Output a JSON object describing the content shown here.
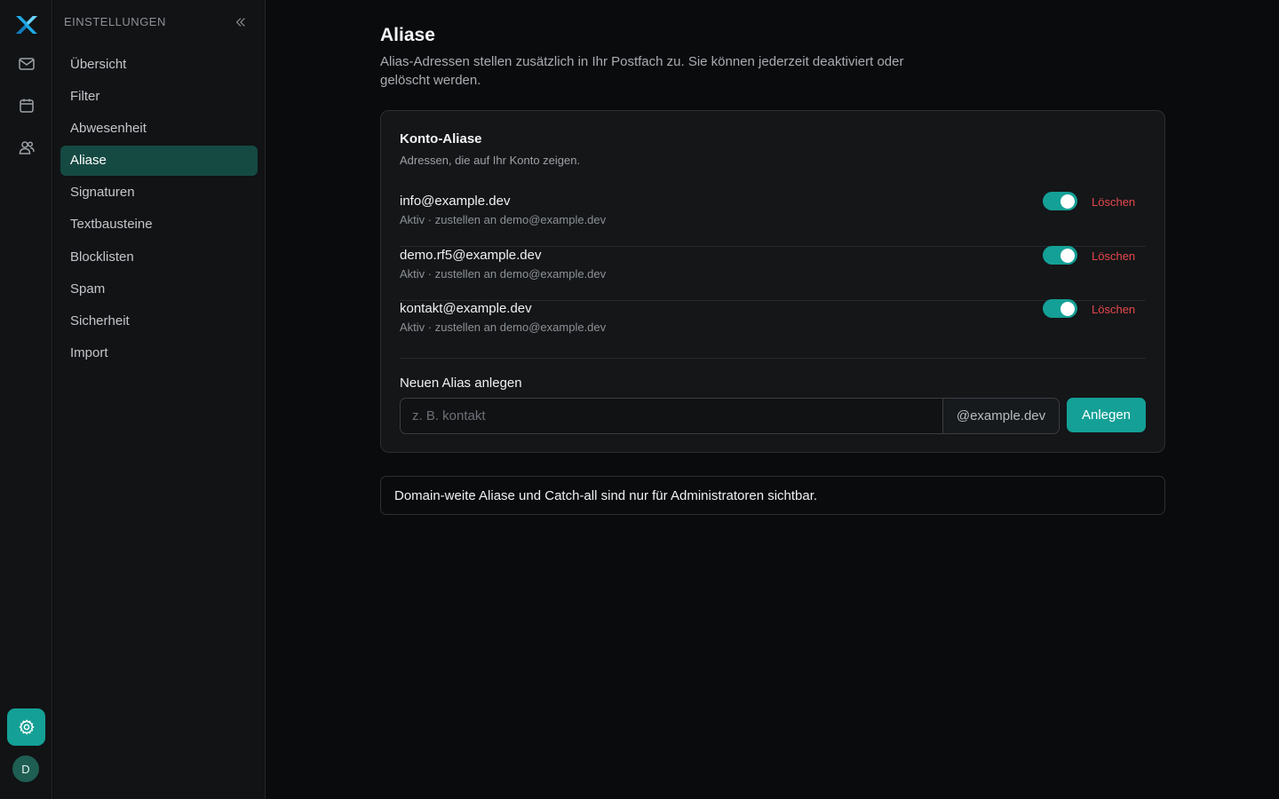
{
  "rail": {
    "avatar_initial": "D",
    "icons": [
      "app-logo",
      "mail-icon",
      "calendar-icon",
      "contacts-icon",
      "gear-icon"
    ]
  },
  "sidebar": {
    "title": "EINSTELLUNGEN",
    "items": [
      {
        "label": "Übersicht"
      },
      {
        "label": "Filter"
      },
      {
        "label": "Abwesenheit"
      },
      {
        "label": "Aliase",
        "active": true
      },
      {
        "label": "Signaturen"
      },
      {
        "label": "Textbausteine"
      },
      {
        "label": "Blocklisten"
      },
      {
        "label": "Spam"
      },
      {
        "label": "Sicherheit"
      },
      {
        "label": "Import"
      }
    ]
  },
  "page": {
    "title": "Aliase",
    "description": "Alias-Adressen stellen zusätzlich in Ihr Postfach zu. Sie können jederzeit deaktiviert oder gelöscht werden."
  },
  "account_aliases": {
    "title": "Konto-Aliase",
    "subtitle": "Adressen, die auf Ihr Konto zeigen.",
    "rows": [
      {
        "email": "info@example.dev",
        "meta": "Aktiv · zustellen an demo@example.dev",
        "enabled": true,
        "delete_label": "Löschen"
      },
      {
        "email": "demo.rf5@example.dev",
        "meta": "Aktiv · zustellen an demo@example.dev",
        "enabled": true,
        "delete_label": "Löschen"
      },
      {
        "email": "kontakt@example.dev",
        "meta": "Aktiv · zustellen an demo@example.dev",
        "enabled": true,
        "delete_label": "Löschen"
      }
    ]
  },
  "new_alias": {
    "title": "Neuen Alias anlegen",
    "placeholder": "z. B. kontakt",
    "value": "",
    "domain_suffix": "@example.dev",
    "create_label": "Anlegen"
  },
  "notice": {
    "text": "Domain-weite Aliase und Catch-all sind nur für Administratoren sichtbar."
  },
  "colors": {
    "accent": "#14a096",
    "danger": "#e5484d",
    "background": "#0a0b0d",
    "panel": "#111315"
  }
}
